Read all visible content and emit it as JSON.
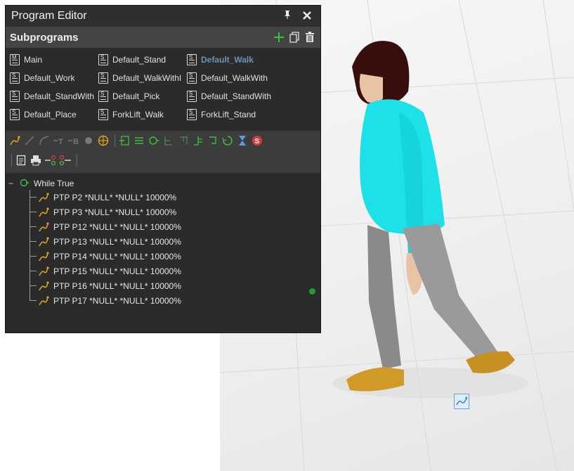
{
  "window": {
    "title": "Program Editor",
    "pin_icon": "pin-icon",
    "close_icon": "close-icon"
  },
  "subprograms": {
    "header": "Subprograms",
    "actions": [
      "add-icon",
      "copy-icon",
      "trash-icon"
    ],
    "items": [
      {
        "label": "Main",
        "letter": "M",
        "active": false
      },
      {
        "label": "Default_Stand",
        "letter": "S",
        "active": false
      },
      {
        "label": "Default_Walk",
        "letter": "S",
        "active": true
      },
      {
        "label": "Default_Work",
        "letter": "S",
        "active": false
      },
      {
        "label": "Default_WalkWithI",
        "letter": "S",
        "active": false
      },
      {
        "label": "Default_WalkWith",
        "letter": "S",
        "active": false
      },
      {
        "label": "Default_StandWith",
        "letter": "S",
        "active": false
      },
      {
        "label": "Default_Pick",
        "letter": "S",
        "active": false
      },
      {
        "label": "Default_StandWith",
        "letter": "S",
        "active": false
      },
      {
        "label": "Default_Place",
        "letter": "S",
        "active": false
      },
      {
        "label": "ForkLift_Walk",
        "letter": "S",
        "active": false
      },
      {
        "label": "ForkLift_Stand",
        "letter": "S",
        "active": false
      }
    ]
  },
  "toolbar": {
    "row1": [
      "ptp-icon",
      "lin-icon",
      "circ-icon",
      "set-tcp-icon",
      "set-base-icon",
      "dot-icon",
      "globe-icon",
      "subprogram-call-icon",
      "list-icon",
      "while-icon",
      "if-icon",
      "else-icon",
      "switch-icon",
      "return-icon",
      "loop-icon",
      "hourglass-icon",
      "stop-icon"
    ],
    "row2": [
      "document-icon",
      "print-icon",
      "move-in-icon",
      "move-out-icon"
    ]
  },
  "tree": {
    "root": "While True",
    "statements": [
      "PTP P2 *NULL* *NULL* 10000%",
      "PTP P3 *NULL* *NULL* 10000%",
      "PTP P12 *NULL* *NULL* 10000%",
      "PTP P13 *NULL* *NULL* 10000%",
      "PTP P14 *NULL* *NULL* 10000%",
      "PTP P15 *NULL* *NULL* 10000%",
      "PTP P16 *NULL* *NULL* 10000%",
      "PTP P17 *NULL* *NULL* 10000%"
    ]
  },
  "colors": {
    "panel_bg": "#2b2b2b",
    "header_bg": "#444444",
    "active_item": "#6b93b3",
    "green": "#3cbf3c",
    "ptp_orange": "#e0a020"
  }
}
